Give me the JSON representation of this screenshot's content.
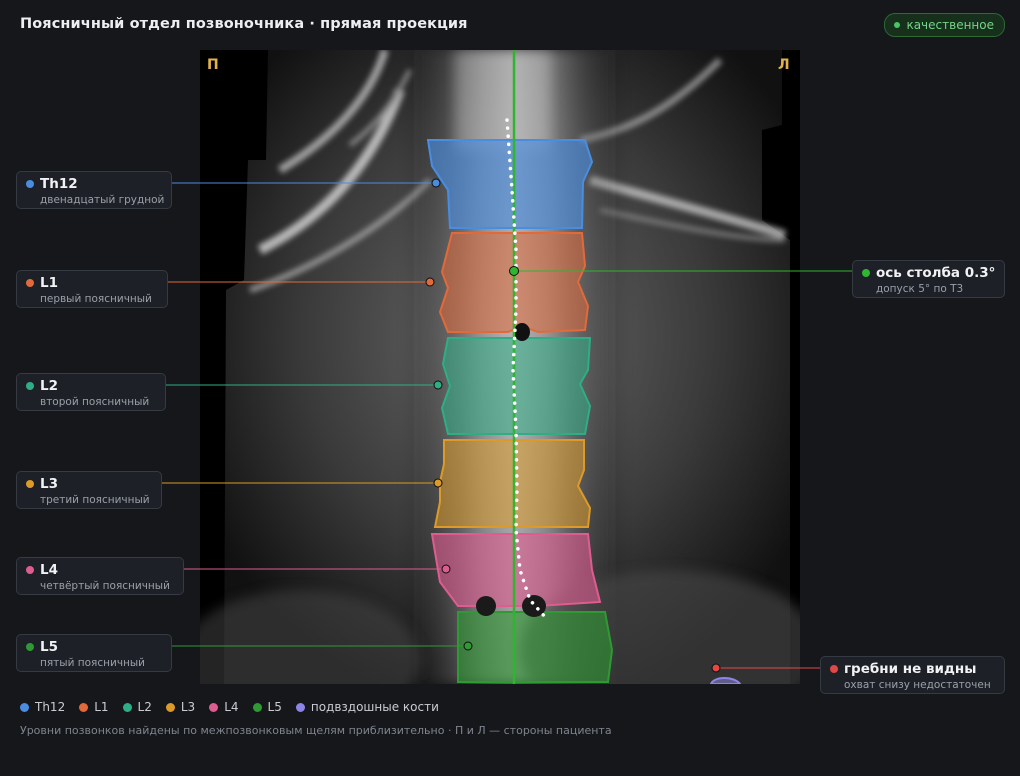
{
  "header": {
    "title": "Поясничный отдел позвоночника · прямая проекция",
    "quality_label": "качественное"
  },
  "scan": {
    "side_right": "П",
    "side_left": "Л"
  },
  "colors": {
    "Th12": "#4a8de0",
    "L1": "#e26a3a",
    "L2": "#2fae86",
    "L3": "#dc9a2a",
    "L4": "#df5c91",
    "L5": "#2f9a33",
    "iliac": "#8d85e6",
    "axis": "#2fb52f",
    "warning": "#e04848"
  },
  "vertebrae": [
    {
      "key": "Th12",
      "name": "Th12",
      "desc": "двенадцатый грудной"
    },
    {
      "key": "L1",
      "name": "L1",
      "desc": "первый поясничный"
    },
    {
      "key": "L2",
      "name": "L2",
      "desc": "второй поясничный"
    },
    {
      "key": "L3",
      "name": "L3",
      "desc": "третий поясничный"
    },
    {
      "key": "L4",
      "name": "L4",
      "desc": "четвёртый поясничный"
    },
    {
      "key": "L5",
      "name": "L5",
      "desc": "пятый поясничный"
    }
  ],
  "axis": {
    "label": "ось столба 0.3°",
    "note": "допуск 5° по Т3"
  },
  "iliac": {
    "label": "гребни не видны",
    "note": "охват снизу недостаточен"
  },
  "legend": [
    {
      "key": "Th12",
      "label": "Th12"
    },
    {
      "key": "L1",
      "label": "L1"
    },
    {
      "key": "L2",
      "label": "L2"
    },
    {
      "key": "L3",
      "label": "L3"
    },
    {
      "key": "L4",
      "label": "L4"
    },
    {
      "key": "L5",
      "label": "L5"
    },
    {
      "key": "iliac",
      "label": "подвздошные кости"
    }
  ],
  "footnote": "Уровни позвонков найдены по межпозвонковым щелям приблизительно · П и Л — стороны пациента"
}
